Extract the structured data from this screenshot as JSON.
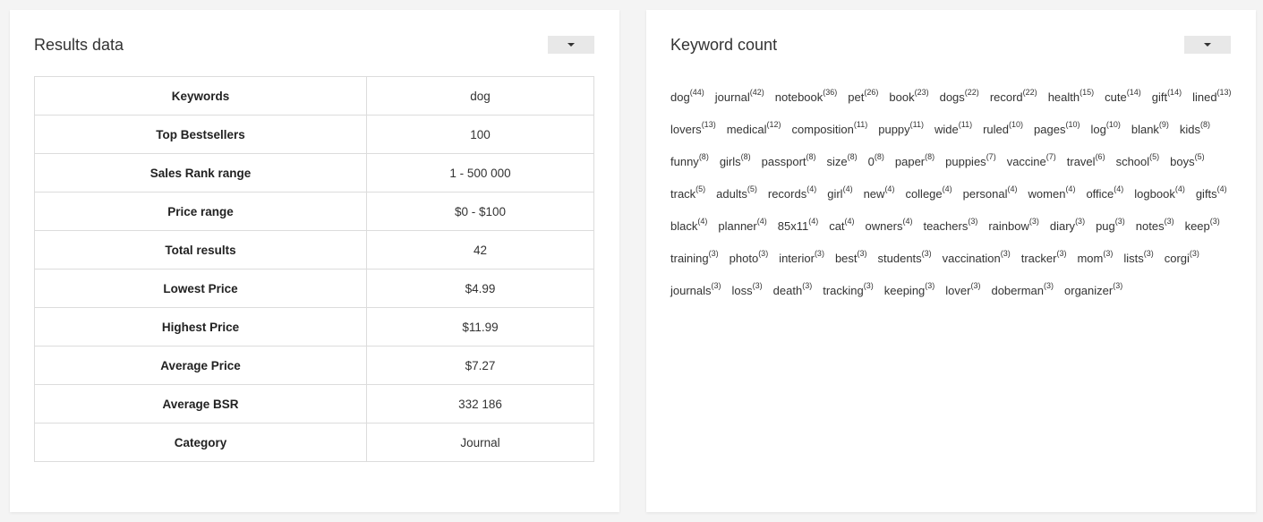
{
  "results_panel": {
    "title": "Results data",
    "rows": [
      {
        "key": "Keywords",
        "value": "dog"
      },
      {
        "key": "Top Bestsellers",
        "value": "100"
      },
      {
        "key": "Sales Rank range",
        "value": "1 - 500 000"
      },
      {
        "key": "Price range",
        "value": "$0 - $100"
      },
      {
        "key": "Total results",
        "value": "42"
      },
      {
        "key": "Lowest Price",
        "value": "$4.99"
      },
      {
        "key": "Highest Price",
        "value": "$11.99"
      },
      {
        "key": "Average Price",
        "value": "$7.27"
      },
      {
        "key": "Average BSR",
        "value": "332 186"
      },
      {
        "key": "Category",
        "value": "Journal"
      }
    ]
  },
  "keyword_panel": {
    "title": "Keyword count",
    "keywords": [
      {
        "word": "dog",
        "count": "(44)"
      },
      {
        "word": "journal",
        "count": "(42)"
      },
      {
        "word": "notebook",
        "count": "(36)"
      },
      {
        "word": "pet",
        "count": "(26)"
      },
      {
        "word": "book",
        "count": "(23)"
      },
      {
        "word": "dogs",
        "count": "(22)"
      },
      {
        "word": "record",
        "count": "(22)"
      },
      {
        "word": "health",
        "count": "(15)"
      },
      {
        "word": "cute",
        "count": "(14)"
      },
      {
        "word": "gift",
        "count": "(14)"
      },
      {
        "word": "lined",
        "count": "(13)"
      },
      {
        "word": "lovers",
        "count": "(13)"
      },
      {
        "word": "medical",
        "count": "(12)"
      },
      {
        "word": "composition",
        "count": "(11)"
      },
      {
        "word": "puppy",
        "count": "(11)"
      },
      {
        "word": "wide",
        "count": "(11)"
      },
      {
        "word": "ruled",
        "count": "(10)"
      },
      {
        "word": "pages",
        "count": "(10)"
      },
      {
        "word": "log",
        "count": "(10)"
      },
      {
        "word": "blank",
        "count": "(9)"
      },
      {
        "word": "kids",
        "count": "(8)"
      },
      {
        "word": "funny",
        "count": "(8)"
      },
      {
        "word": "girls",
        "count": "(8)"
      },
      {
        "word": "passport",
        "count": "(8)"
      },
      {
        "word": "size",
        "count": "(8)"
      },
      {
        "word": "0",
        "count": "(8)"
      },
      {
        "word": "paper",
        "count": "(8)"
      },
      {
        "word": "puppies",
        "count": "(7)"
      },
      {
        "word": "vaccine",
        "count": "(7)"
      },
      {
        "word": "travel",
        "count": "(6)"
      },
      {
        "word": "school",
        "count": "(5)"
      },
      {
        "word": "boys",
        "count": "(5)"
      },
      {
        "word": "track",
        "count": "(5)"
      },
      {
        "word": "adults",
        "count": "(5)"
      },
      {
        "word": "records",
        "count": "(4)"
      },
      {
        "word": "girl",
        "count": "(4)"
      },
      {
        "word": "new",
        "count": "(4)"
      },
      {
        "word": "college",
        "count": "(4)"
      },
      {
        "word": "personal",
        "count": "(4)"
      },
      {
        "word": "women",
        "count": "(4)"
      },
      {
        "word": "office",
        "count": "(4)"
      },
      {
        "word": "logbook",
        "count": "(4)"
      },
      {
        "word": "gifts",
        "count": "(4)"
      },
      {
        "word": "black",
        "count": "(4)"
      },
      {
        "word": "planner",
        "count": "(4)"
      },
      {
        "word": "85x11",
        "count": "(4)"
      },
      {
        "word": "cat",
        "count": "(4)"
      },
      {
        "word": "owners",
        "count": "(4)"
      },
      {
        "word": "teachers",
        "count": "(3)"
      },
      {
        "word": "rainbow",
        "count": "(3)"
      },
      {
        "word": "diary",
        "count": "(3)"
      },
      {
        "word": "pug",
        "count": "(3)"
      },
      {
        "word": "notes",
        "count": "(3)"
      },
      {
        "word": "keep",
        "count": "(3)"
      },
      {
        "word": "training",
        "count": "(3)"
      },
      {
        "word": "photo",
        "count": "(3)"
      },
      {
        "word": "interior",
        "count": "(3)"
      },
      {
        "word": "best",
        "count": "(3)"
      },
      {
        "word": "students",
        "count": "(3)"
      },
      {
        "word": "vaccination",
        "count": "(3)"
      },
      {
        "word": "tracker",
        "count": "(3)"
      },
      {
        "word": "mom",
        "count": "(3)"
      },
      {
        "word": "lists",
        "count": "(3)"
      },
      {
        "word": "corgi",
        "count": "(3)"
      },
      {
        "word": "journals",
        "count": "(3)"
      },
      {
        "word": "loss",
        "count": "(3)"
      },
      {
        "word": "death",
        "count": "(3)"
      },
      {
        "word": "tracking",
        "count": "(3)"
      },
      {
        "word": "keeping",
        "count": "(3)"
      },
      {
        "word": "lover",
        "count": "(3)"
      },
      {
        "word": "doberman",
        "count": "(3)"
      },
      {
        "word": "organizer",
        "count": "(3)"
      }
    ]
  },
  "icons": {
    "dropdown": "caret-down-icon"
  }
}
